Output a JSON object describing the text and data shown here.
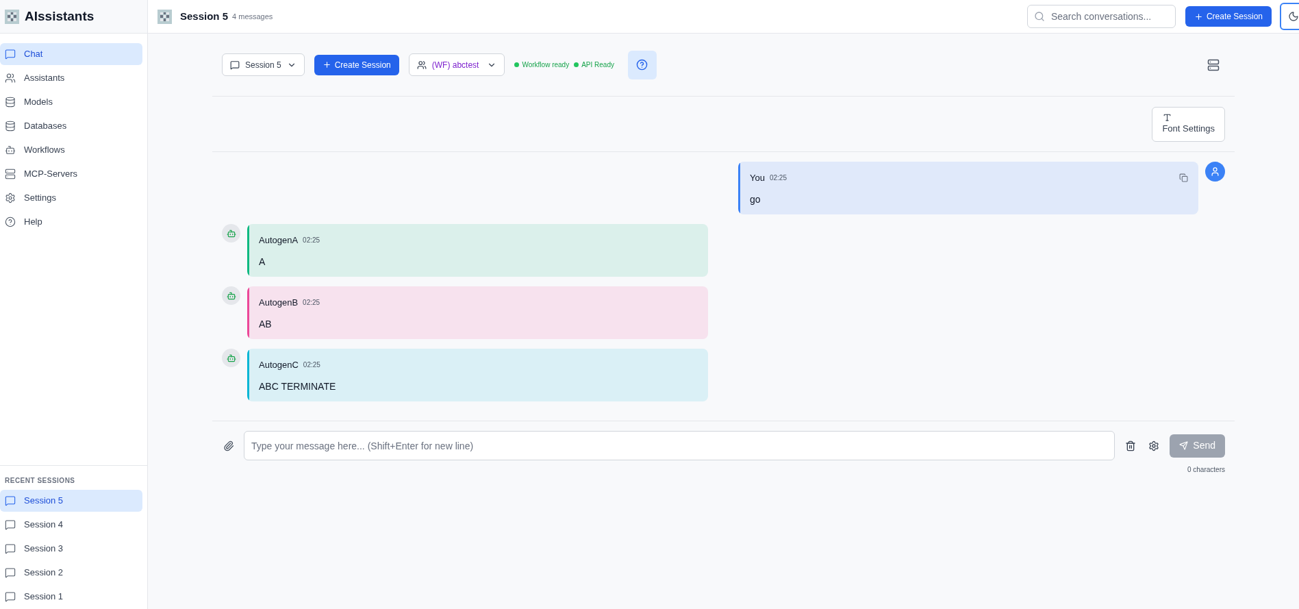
{
  "sidebar": {
    "app_title": "AIssistants",
    "nav": [
      {
        "label": "Chat",
        "selected": true
      },
      {
        "label": "Assistants",
        "selected": false
      },
      {
        "label": "Models",
        "selected": false
      },
      {
        "label": "Databases",
        "selected": false
      },
      {
        "label": "Workflows",
        "selected": false
      },
      {
        "label": "MCP-Servers",
        "selected": false
      },
      {
        "label": "Settings",
        "selected": false
      },
      {
        "label": "Help",
        "selected": false
      }
    ],
    "recent_heading": "RECENT SESSIONS",
    "recent_sessions": [
      {
        "label": "Session 5",
        "selected": true
      },
      {
        "label": "Session 4",
        "selected": false
      },
      {
        "label": "Session 3",
        "selected": false
      },
      {
        "label": "Session 2",
        "selected": false
      },
      {
        "label": "Session 1",
        "selected": false
      }
    ]
  },
  "header": {
    "title": "Session 5",
    "subtitle": "4 messages",
    "search": {
      "placeholder": "Search conversations..."
    },
    "create_button": "Create Session"
  },
  "toolbar": {
    "session_select": "Session 5",
    "create_button": "Create Session",
    "assistant_select": "(WF) abctest",
    "statuses": [
      {
        "label": "Workflow ready",
        "color": "#22c55e"
      },
      {
        "label": "API Ready",
        "color": "#22c55e"
      }
    ],
    "font_settings": "Font Settings"
  },
  "messages": [
    {
      "kind": "user",
      "sender": "You",
      "time": "02:25",
      "text": "go",
      "color": "#3b82f6"
    },
    {
      "kind": "agent",
      "sender": "AutogenA",
      "time": "02:25",
      "text": "A",
      "color": "#10b981"
    },
    {
      "kind": "agent",
      "sender": "AutogenB",
      "time": "02:25",
      "text": "AB",
      "color": "#ec4899"
    },
    {
      "kind": "agent",
      "sender": "AutogenC",
      "time": "02:25",
      "text": "ABC TERMINATE",
      "color": "#06b6d4"
    }
  ],
  "composer": {
    "placeholder": "Type your message here... (Shift+Enter for new line)",
    "send_button": "Send",
    "send_disabled": true,
    "char_count": "0 characters"
  }
}
